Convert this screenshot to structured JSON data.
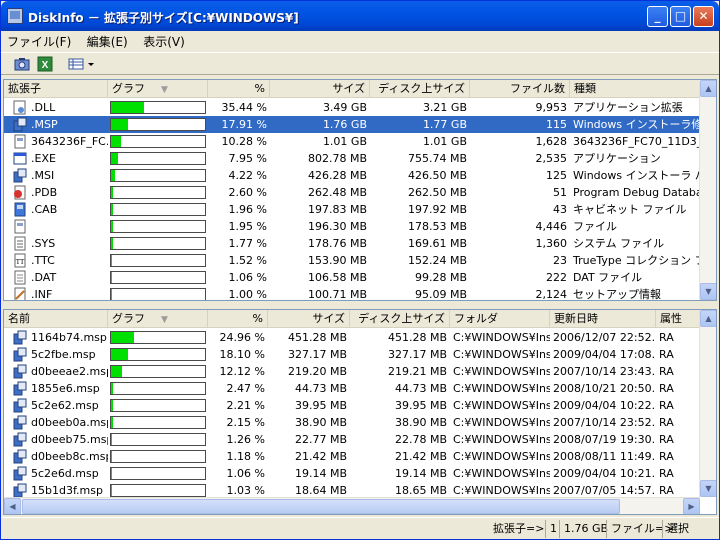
{
  "window": {
    "title": "DiskInfo － 拡張子別サイズ[C:¥WINDOWS¥]"
  },
  "menu": [
    "ファイル(F)",
    "編集(E)",
    "表示(V)"
  ],
  "toolbar": {
    "icons": [
      "camera-icon",
      "excel-icon",
      "view-icon",
      "dropdown-arrow-icon"
    ]
  },
  "ext_table": {
    "headers": [
      "拡張子",
      "グラフ",
      "%",
      "サイズ",
      "ディスク上サイズ",
      "ファイル数",
      "種類"
    ],
    "rows": [
      {
        "icon": "dll-file-icon",
        "ext": ".DLL",
        "pct": "35.44 %",
        "ratio": 0.3544,
        "size": "3.49 GB",
        "disk": "3.21 GB",
        "count": "9,953",
        "type": "アプリケーション拡張",
        "selected": false
      },
      {
        "icon": "msp-file-icon",
        "ext": ".MSP",
        "pct": "17.91 %",
        "ratio": 0.1791,
        "size": "1.76 GB",
        "disk": "1.77 GB",
        "count": "115",
        "type": "Windows インストーラ修...",
        "selected": true
      },
      {
        "icon": "generic-file-icon",
        "ext": "3643236F_FC...",
        "pct": "10.28 %",
        "ratio": 0.1028,
        "size": "1.01 GB",
        "disk": "1.01 GB",
        "count": "1,628",
        "type": "3643236F_FC70_11D3_...",
        "selected": false
      },
      {
        "icon": "exe-file-icon",
        "ext": ".EXE",
        "pct": "7.95 %",
        "ratio": 0.0795,
        "size": "802.78 MB",
        "disk": "755.74 MB",
        "count": "2,535",
        "type": "アプリケーション",
        "selected": false
      },
      {
        "icon": "msi-file-icon",
        "ext": ".MSI",
        "pct": "4.22 %",
        "ratio": 0.0422,
        "size": "426.28 MB",
        "disk": "426.50 MB",
        "count": "125",
        "type": "Windows インストーラ パ...",
        "selected": false
      },
      {
        "icon": "pdb-file-icon",
        "ext": ".PDB",
        "pct": "2.60 %",
        "ratio": 0.026,
        "size": "262.48 MB",
        "disk": "262.50 MB",
        "count": "51",
        "type": "Program Debug Databa...",
        "selected": false
      },
      {
        "icon": "cab-file-icon",
        "ext": ".CAB",
        "pct": "1.96 %",
        "ratio": 0.0196,
        "size": "197.83 MB",
        "disk": "197.92 MB",
        "count": "43",
        "type": "キャビネット ファイル",
        "selected": false
      },
      {
        "icon": "generic-file-icon",
        "ext": "",
        "pct": "1.95 %",
        "ratio": 0.0195,
        "size": "196.30 MB",
        "disk": "178.53 MB",
        "count": "4,446",
        "type": "ファイル",
        "selected": false
      },
      {
        "icon": "sys-file-icon",
        "ext": ".SYS",
        "pct": "1.77 %",
        "ratio": 0.0177,
        "size": "178.76 MB",
        "disk": "169.61 MB",
        "count": "1,360",
        "type": "システム ファイル",
        "selected": false
      },
      {
        "icon": "ttc-file-icon",
        "ext": ".TTC",
        "pct": "1.52 %",
        "ratio": 0.0152,
        "size": "153.90 MB",
        "disk": "152.24 MB",
        "count": "23",
        "type": "TrueType コレクション フ...",
        "selected": false
      },
      {
        "icon": "dat-file-icon",
        "ext": ".DAT",
        "pct": "1.06 %",
        "ratio": 0.0106,
        "size": "106.58 MB",
        "disk": "99.28 MB",
        "count": "222",
        "type": "DAT ファイル",
        "selected": false
      },
      {
        "icon": "inf-file-icon",
        "ext": ".INF",
        "pct": "1.00 %",
        "ratio": 0.01,
        "size": "100.71 MB",
        "disk": "95.09 MB",
        "count": "2,124",
        "type": "セットアップ情報",
        "selected": false
      }
    ]
  },
  "file_table": {
    "headers": [
      "名前",
      "グラフ",
      "%",
      "サイズ",
      "ディスク上サイズ",
      "フォルダ",
      "更新日時",
      "属性"
    ],
    "rows": [
      {
        "name": "1164b74.msp",
        "pct": "24.96 %",
        "ratio": 0.2496,
        "size": "451.28 MB",
        "disk": "451.28 MB",
        "folder": "C:¥WINDOWS¥Ins...",
        "date": "2006/12/07 22:52...",
        "attr": "RA"
      },
      {
        "name": "5c2fbe.msp",
        "pct": "18.10 %",
        "ratio": 0.181,
        "size": "327.17 MB",
        "disk": "327.17 MB",
        "folder": "C:¥WINDOWS¥Ins...",
        "date": "2009/04/04 17:08...",
        "attr": "RA"
      },
      {
        "name": "d0beeae2.msp",
        "pct": "12.12 %",
        "ratio": 0.1212,
        "size": "219.20 MB",
        "disk": "219.21 MB",
        "folder": "C:¥WINDOWS¥Ins...",
        "date": "2007/10/14 23:43...",
        "attr": "RA"
      },
      {
        "name": "1855e6.msp",
        "pct": "2.47 %",
        "ratio": 0.0247,
        "size": "44.73 MB",
        "disk": "44.73 MB",
        "folder": "C:¥WINDOWS¥Ins...",
        "date": "2008/10/21 20:50...",
        "attr": "RA"
      },
      {
        "name": "5c2e62.msp",
        "pct": "2.21 %",
        "ratio": 0.0221,
        "size": "39.95 MB",
        "disk": "39.95 MB",
        "folder": "C:¥WINDOWS¥Ins...",
        "date": "2009/04/04 10:22...",
        "attr": "RA"
      },
      {
        "name": "d0beeb0a.msp",
        "pct": "2.15 %",
        "ratio": 0.0215,
        "size": "38.90 MB",
        "disk": "38.90 MB",
        "folder": "C:¥WINDOWS¥Ins...",
        "date": "2007/10/14 23:52...",
        "attr": "RA"
      },
      {
        "name": "d0beeb75.msp",
        "pct": "1.26 %",
        "ratio": 0.0126,
        "size": "22.77 MB",
        "disk": "22.78 MB",
        "folder": "C:¥WINDOWS¥Ins...",
        "date": "2008/07/19 19:30...",
        "attr": "RA"
      },
      {
        "name": "d0beeb8c.msp",
        "pct": "1.18 %",
        "ratio": 0.0118,
        "size": "21.42 MB",
        "disk": "21.42 MB",
        "folder": "C:¥WINDOWS¥Ins...",
        "date": "2008/08/11 11:49...",
        "attr": "RA"
      },
      {
        "name": "5c2e6d.msp",
        "pct": "1.06 %",
        "ratio": 0.0106,
        "size": "19.14 MB",
        "disk": "19.14 MB",
        "folder": "C:¥WINDOWS¥Ins...",
        "date": "2009/04/04 10:21...",
        "attr": "RA"
      },
      {
        "name": "15b1d3f.msp",
        "pct": "1.03 %",
        "ratio": 0.0103,
        "size": "18.64 MB",
        "disk": "18.65 MB",
        "folder": "C:¥WINDOWS¥Ins...",
        "date": "2007/07/05 14:57...",
        "attr": "RA"
      }
    ]
  },
  "status": {
    "ext_label": "拡張子=>",
    "ext_value": "1",
    "size_value": "1.76 GB",
    "file_label": "ファイル=>",
    "file_value": "選択"
  },
  "colors": {
    "accent": "#316ac5",
    "bar": "#00e000",
    "title": "#0054e3"
  }
}
